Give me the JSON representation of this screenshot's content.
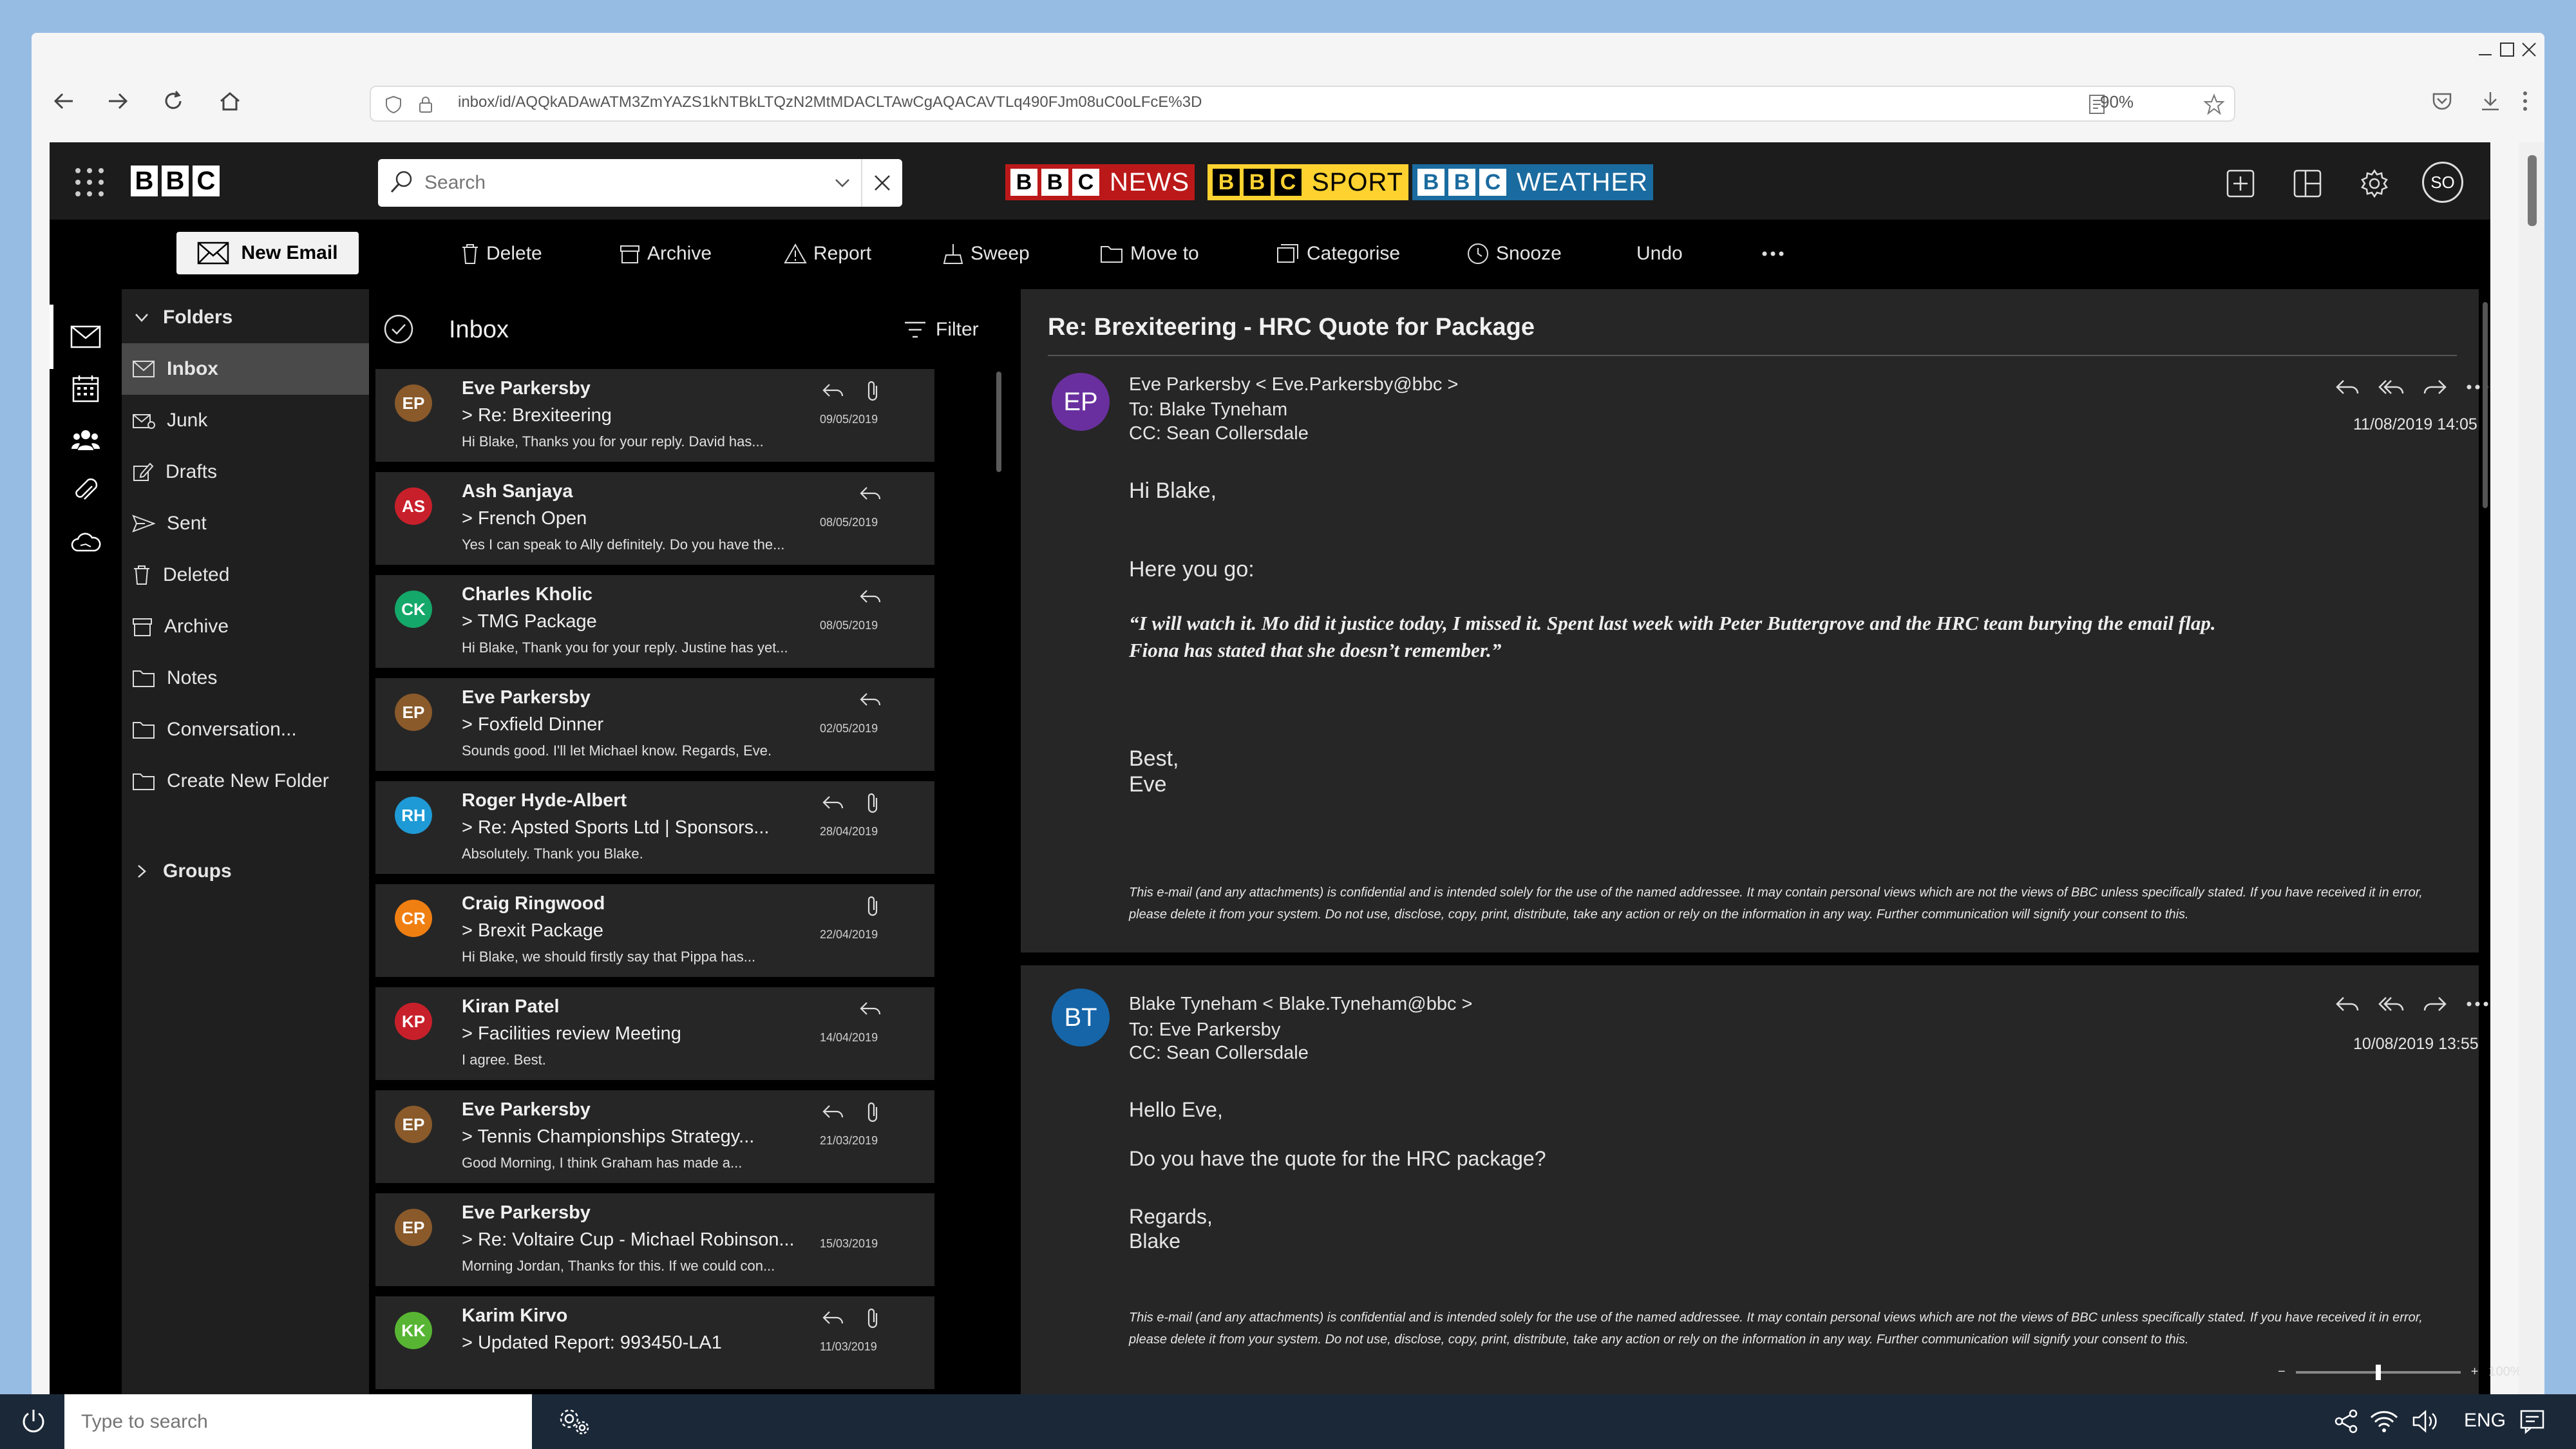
{
  "browser": {
    "url": "inbox/id/AQQkADAwATM3ZmYAZS1kNTBkLTQzN2MtMDACLTAwCgAQACAVTLq490FJm08uC0oLFcE%3D",
    "zoom": "90%"
  },
  "header": {
    "logo_letters": [
      "B",
      "B",
      "C"
    ],
    "search_placeholder": "Search",
    "brands": [
      {
        "text": "NEWS",
        "color": "#bb1919"
      },
      {
        "text": "SPORT",
        "color": "#ffd230"
      },
      {
        "text": "WEATHER",
        "color": "#1a6b9f"
      }
    ],
    "user_initials": "SO"
  },
  "toolbar": {
    "new_email": "New Email",
    "delete": "Delete",
    "archive": "Archive",
    "report": "Report",
    "sweep": "Sweep",
    "move_to": "Move to",
    "categorise": "Categorise",
    "snooze": "Snooze",
    "undo": "Undo"
  },
  "folders": {
    "heading": "Folders",
    "items": [
      {
        "label": "Inbox",
        "icon": "envelope-icon",
        "selected": true
      },
      {
        "label": "Junk",
        "icon": "junk-icon"
      },
      {
        "label": "Drafts",
        "icon": "pencil-icon"
      },
      {
        "label": "Sent",
        "icon": "send-icon"
      },
      {
        "label": "Deleted",
        "icon": "trash-icon"
      },
      {
        "label": "Archive",
        "icon": "archive-icon"
      },
      {
        "label": "Notes",
        "icon": "folder-icon"
      },
      {
        "label": "Conversation...",
        "icon": "folder-icon"
      },
      {
        "label": "Create New Folder",
        "icon": "folder-icon"
      }
    ],
    "groups": "Groups"
  },
  "list": {
    "title": "Inbox",
    "filter": "Filter",
    "emails": [
      {
        "initials": "EP",
        "color": "#8a5a2b",
        "sender": "Eve Parkersby",
        "subject": "> Re: Brexiteering",
        "preview": "Hi Blake, Thanks you for your reply. David has...",
        "date": "09/05/2019",
        "reply": true,
        "attach": true
      },
      {
        "initials": "AS",
        "color": "#c8202b",
        "sender": "Ash Sanjaya",
        "subject": "> French Open",
        "preview": "Yes I can speak to Ally definitely. Do you have the...",
        "date": "08/05/2019",
        "reply": true,
        "attach": false
      },
      {
        "initials": "CK",
        "color": "#14a86a",
        "sender": "Charles Kholic",
        "subject": "> TMG Package",
        "preview": "Hi Blake, Thank you for your reply. Justine has yet...",
        "date": "08/05/2019",
        "reply": true,
        "attach": false
      },
      {
        "initials": "EP",
        "color": "#8a5a2b",
        "sender": "Eve Parkersby",
        "subject": "> Foxfield Dinner",
        "preview": "Sounds good. I'll let Michael know. Regards, Eve.",
        "date": "02/05/2019",
        "reply": true,
        "attach": false
      },
      {
        "initials": "RH",
        "color": "#1e9ad6",
        "sender": "Roger Hyde-Albert",
        "subject": "> Re: Apsted Sports Ltd | Sponsors...",
        "preview": "Absolutely. Thank you Blake.",
        "date": "28/04/2019",
        "reply": true,
        "attach": true
      },
      {
        "initials": "CR",
        "color": "#f07f12",
        "sender": "Craig Ringwood",
        "subject": "> Brexit Package",
        "preview": "Hi Blake, we should firstly say that Pippa has...",
        "date": "22/04/2019",
        "reply": false,
        "attach": true
      },
      {
        "initials": "KP",
        "color": "#c8202b",
        "sender": "Kiran Patel",
        "subject": "> Facilities review Meeting",
        "preview": "I agree. Best.",
        "date": "14/04/2019",
        "reply": true,
        "attach": false
      },
      {
        "initials": "EP",
        "color": "#8a5a2b",
        "sender": "Eve Parkersby",
        "subject": "> Tennis Championships Strategy...",
        "preview": "Good Morning, I think Graham has made a...",
        "date": "21/03/2019",
        "reply": true,
        "attach": true
      },
      {
        "initials": "EP",
        "color": "#8a5a2b",
        "sender": "Eve Parkersby",
        "subject": "> Re: Voltaire Cup - Michael Robinson...",
        "preview": "Morning Jordan, Thanks for this. If we could con...",
        "date": "15/03/2019",
        "reply": false,
        "attach": false
      },
      {
        "initials": "KK",
        "color": "#57b533",
        "sender": "Karim Kirvo",
        "subject": "> Updated Report: 993450-LA1",
        "preview": "",
        "date": "11/03/2019",
        "reply": true,
        "attach": true
      }
    ]
  },
  "reading": {
    "subject": "Re: Brexiteering - HRC Quote for Package",
    "messages": [
      {
        "initials": "EP",
        "color": "#6a2f9e",
        "from": "Eve Parkersby < Eve.Parkersby@bbc >",
        "to": "To: Blake Tyneham",
        "cc": "CC: Sean Collersdale",
        "datetime": "11/08/2019  14:05",
        "greeting": "Hi Blake,",
        "line1": "Here you go:",
        "quote1": "“I will watch it. Mo did it justice today, I missed it. Spent last week with Peter Buttergrove and the HRC team burying the email flap.",
        "quote2": "Fiona has stated that she doesn’t remember.”",
        "signoff1": "Best,",
        "signoff2": "Eve",
        "disclaimer": "This e-mail (and any attachments) is confidential and is intended solely for the use of the named addressee.  It may contain personal views which are not the views of BBC unless specifically stated.  If you have received it in error, please delete it from your system.  Do not use, disclose, copy, print, distribute, take any action or rely on the information in any way.  Further communication will signify your consent to this."
      },
      {
        "initials": "BT",
        "color": "#1565a8",
        "from": "Blake Tyneham < Blake.Tyneham@bbc >",
        "to": "To: Eve Parkersby",
        "cc": "CC: Sean Collersdale",
        "datetime": "10/08/2019  13:55",
        "greeting": "Hello Eve,",
        "line1": "Do you have the quote for the HRC package?",
        "signoff1": "Regards,",
        "signoff2": "Blake",
        "disclaimer": "This e-mail (and any attachments) is confidential and is intended solely for the use of the named addressee.  It may contain personal views which are not the views of BBC unless specifically stated.  If you have received it in error, please delete it from your system.  Do not use, disclose, copy, print, distribute, take any action or rely on the information in any way.  Further communication will signify your consent to this."
      }
    ],
    "zoom_level": "100%",
    "zoom_fraction": 0.5
  },
  "taskbar": {
    "search_placeholder": "Type to search",
    "language": "ENG"
  }
}
